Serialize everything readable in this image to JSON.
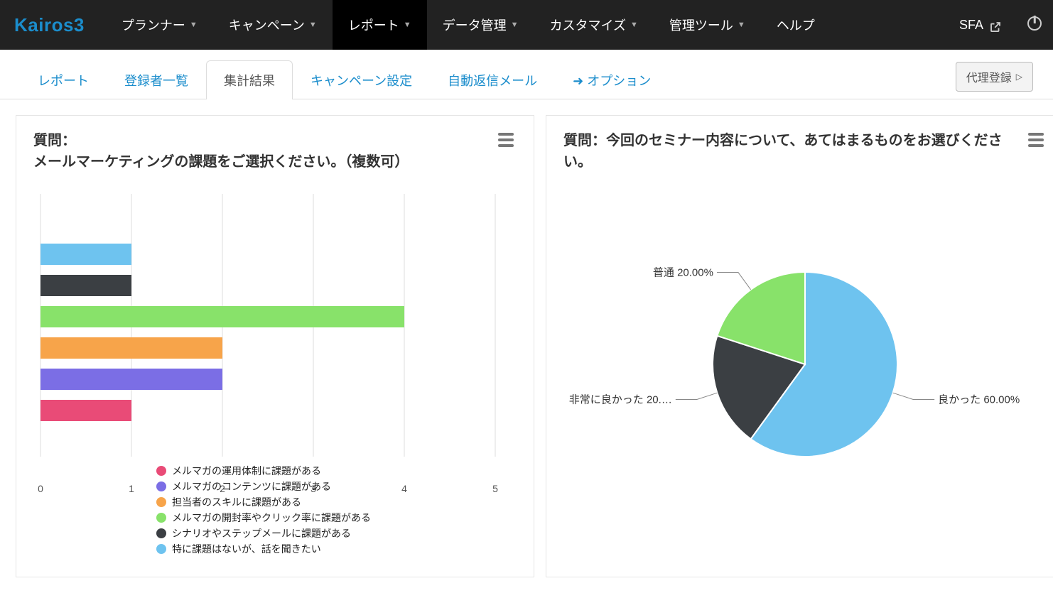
{
  "brand": "Kairos3",
  "nav": {
    "items": [
      {
        "label": "プランナー",
        "hasCaret": true
      },
      {
        "label": "キャンペーン",
        "hasCaret": true
      },
      {
        "label": "レポート",
        "hasCaret": true,
        "active": true
      },
      {
        "label": "データ管理",
        "hasCaret": true
      },
      {
        "label": "カスタマイズ",
        "hasCaret": true
      },
      {
        "label": "管理ツール",
        "hasCaret": true
      },
      {
        "label": "ヘルプ",
        "hasCaret": false
      }
    ],
    "sfa": "SFA"
  },
  "sub": {
    "tabs": [
      {
        "label": "レポート"
      },
      {
        "label": "登録者一覧"
      },
      {
        "label": "集計結果",
        "active": true
      },
      {
        "label": "キャンペーン設定"
      },
      {
        "label": "自動返信メール"
      },
      {
        "label": "オプション",
        "arrow": true
      }
    ],
    "proxy": "代理登録"
  },
  "panel1": {
    "title": "質問：\nメールマーケティングの課題をご選択ください。（複数可）"
  },
  "panel2": {
    "title": "質問：今回のセミナー内容について、あてはまるものをお選びください。"
  },
  "chart_data": [
    {
      "type": "bar",
      "orientation": "horizontal",
      "title": "質問：メールマーケティングの課題をご選択ください。（複数可）",
      "xlim": [
        0,
        5
      ],
      "ticks": [
        0,
        1,
        2,
        3,
        4,
        5
      ],
      "series": [
        {
          "name": "特に課題はないが、話を聞きたい",
          "value": 1,
          "color": "#6ec3ef"
        },
        {
          "name": "シナリオやステップメールに課題がある",
          "value": 1,
          "color": "#3b3f43"
        },
        {
          "name": "メルマガの開封率やクリック率に課題がある",
          "value": 4,
          "color": "#88e26a"
        },
        {
          "name": "担当者のスキルに課題がある",
          "value": 2,
          "color": "#f7a44a"
        },
        {
          "name": "メルマガのコンテンツに課題がある",
          "value": 2,
          "color": "#7b6ee5"
        },
        {
          "name": "メルマガの運用体制に課題がある",
          "value": 1,
          "color": "#e94b77"
        }
      ],
      "legend_order": [
        "メルマガの運用体制に課題がある",
        "メルマガのコンテンツに課題がある",
        "担当者のスキルに課題がある",
        "メルマガの開封率やクリック率に課題がある",
        "シナリオやステップメールに課題がある",
        "特に課題はないが、話を聞きたい"
      ]
    },
    {
      "type": "pie",
      "title": "質問：今回のセミナー内容について、あてはまるものをお選びください。",
      "slices": [
        {
          "name": "良かった",
          "value": 60,
          "label": "良かった 60.00%",
          "color": "#6ec3ef"
        },
        {
          "name": "非常に良かった",
          "value": 20,
          "label": "非常に良かった 20.…",
          "color": "#3b3f43"
        },
        {
          "name": "普通",
          "value": 20,
          "label": "普通 20.00%",
          "color": "#88e26a"
        }
      ]
    }
  ]
}
